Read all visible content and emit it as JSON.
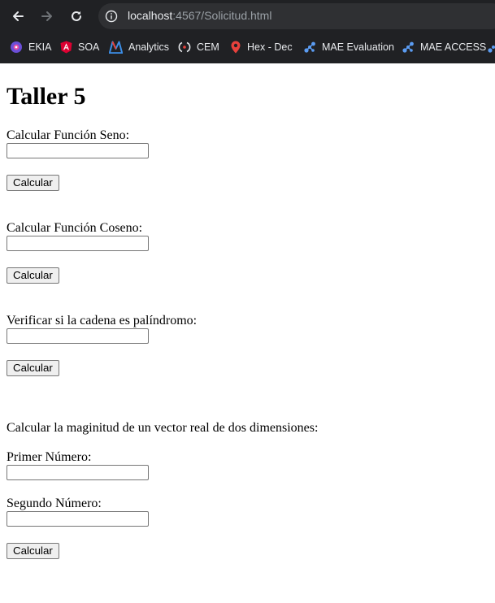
{
  "browser": {
    "url_host": "localhost",
    "url_rest": ":4567/Solicitud.html"
  },
  "bookmarks": [
    {
      "label": "EKIA",
      "icon": "ekia-icon"
    },
    {
      "label": "SOA",
      "icon": "angular-icon"
    },
    {
      "label": "Analytics",
      "icon": "analytics-m-icon"
    },
    {
      "label": "CEM",
      "icon": "cem-icon"
    },
    {
      "label": "Hex - Dec",
      "icon": "map-pin-icon"
    },
    {
      "label": "MAE Evaluation",
      "icon": "molecule-icon"
    },
    {
      "label": "MAE ACCESS",
      "icon": "molecule-icon"
    }
  ],
  "page": {
    "title": "Taller 5",
    "seno": {
      "label": "Calcular Función Seno:",
      "input_value": "",
      "button": "Calcular"
    },
    "coseno": {
      "label": "Calcular Función Coseno:",
      "input_value": "",
      "button": "Calcular"
    },
    "palindromo": {
      "label": "Verificar si la cadena es palíndromo:",
      "input_value": "",
      "button": "Calcular"
    },
    "vector": {
      "heading": "Calcular la maginitud de un vector real de dos dimensiones:",
      "primer_label": "Primer Número:",
      "primer_value": "",
      "segundo_label": "Segundo Número:",
      "segundo_value": "",
      "button": "Calcular"
    }
  }
}
